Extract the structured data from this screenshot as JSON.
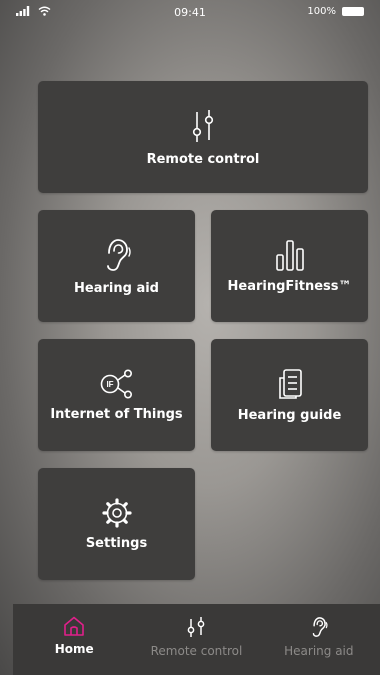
{
  "status_bar": {
    "time": "09:41",
    "battery": "100%"
  },
  "tiles": {
    "remote_control": {
      "label": "Remote control",
      "icon": "sliders-icon"
    },
    "hearing_aid": {
      "label": "Hearing aid",
      "icon": "ear-icon"
    },
    "hearing_fitness": {
      "label": "HearingFitness™",
      "icon": "bars-icon"
    },
    "internet_of_things": {
      "label": "Internet of Things",
      "icon": "iot-icon"
    },
    "hearing_guide": {
      "label": "Hearing guide",
      "icon": "guide-icon"
    },
    "settings": {
      "label": "Settings",
      "icon": "gear-icon"
    }
  },
  "nav": {
    "items": [
      {
        "label": "Home",
        "icon": "home-icon",
        "active": true
      },
      {
        "label": "Remote control",
        "icon": "sliders-icon",
        "active": false
      },
      {
        "label": "Hearing aid",
        "icon": "ear-icon",
        "active": false
      }
    ]
  },
  "colors": {
    "tile": "#3f3e3d",
    "nav_bg": "#3a3938",
    "accent": "#e0208a",
    "inactive": "#8c8a88"
  }
}
